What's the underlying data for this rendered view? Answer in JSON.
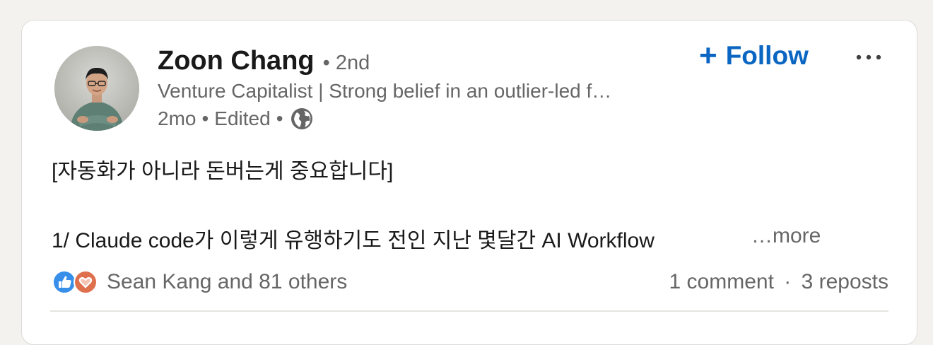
{
  "author": {
    "name": "Zoon Chang",
    "degree": "• 2nd",
    "headline": "Venture Capitalist | Strong belief in an outlier-led f…",
    "time": "2mo",
    "edited": "Edited",
    "sep1": "•",
    "sep2": "•",
    "visibility_icon": "globe-icon"
  },
  "actions": {
    "follow_plus": "+",
    "follow_label": "Follow",
    "more_icon": "ellipsis-icon"
  },
  "post": {
    "line1": "[자동화가 아니라 돈버는게 중요합니다]",
    "line2": "1/ Claude code가 이렇게 유행하기도 전인 지난 몇달간 AI Workflow",
    "see_more": "…more"
  },
  "social": {
    "reactions_text": "Sean Kang and 81 others",
    "comments": "1 comment",
    "separator": "·",
    "reposts": "3 reposts",
    "like_color": "#378fe9",
    "love_color": "#df704d"
  }
}
